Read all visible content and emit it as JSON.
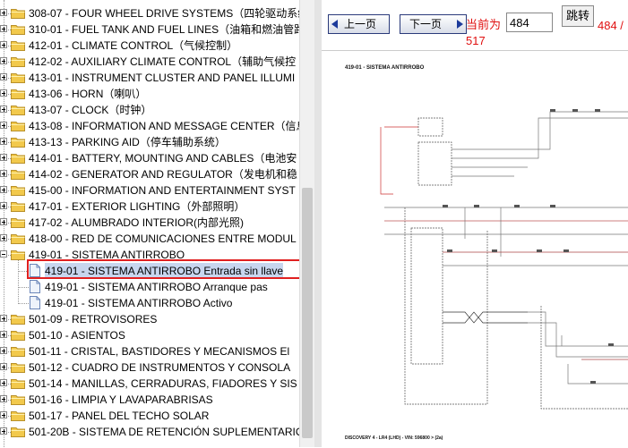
{
  "tree": {
    "items": [
      {
        "label": "308-07 - FOUR WHEEL DRIVE SYSTEMS（四轮驱动系统",
        "expand": "plus",
        "type": "folder"
      },
      {
        "label": "310-01 - FUEL TANK AND FUEL LINES（油箱和燃油管路",
        "expand": "plus",
        "type": "folder"
      },
      {
        "label": "412-01 - CLIMATE CONTROL（气候控制）",
        "expand": "plus",
        "type": "folder"
      },
      {
        "label": "412-02 - AUXILIARY CLIMATE CONTROL（辅助气候控",
        "expand": "plus",
        "type": "folder"
      },
      {
        "label": "413-01 - INSTRUMENT CLUSTER AND PANEL ILLUMI",
        "expand": "plus",
        "type": "folder"
      },
      {
        "label": "413-06 - HORN（喇叭）",
        "expand": "plus",
        "type": "folder"
      },
      {
        "label": "413-07 - CLOCK（时钟）",
        "expand": "plus",
        "type": "folder"
      },
      {
        "label": "413-08 - INFORMATION AND MESSAGE CENTER（信息",
        "expand": "plus",
        "type": "folder"
      },
      {
        "label": "413-13 - PARKING AID（停车辅助系统）",
        "expand": "plus",
        "type": "folder"
      },
      {
        "label": "414-01 - BATTERY, MOUNTING AND CABLES（电池安",
        "expand": "plus",
        "type": "folder"
      },
      {
        "label": "414-02 - GENERATOR AND REGULATOR（发电机和稳",
        "expand": "plus",
        "type": "folder"
      },
      {
        "label": "415-00 - INFORMATION AND ENTERTAINMENT SYST",
        "expand": "plus",
        "type": "folder"
      },
      {
        "label": "417-01 - EXTERIOR LIGHTING（外部照明）",
        "expand": "plus",
        "type": "folder"
      },
      {
        "label": "417-02 - ALUMBRADO INTERIOR(内部光照)",
        "expand": "plus",
        "type": "folder"
      },
      {
        "label": "418-00 - RED DE COMUNICACIONES ENTRE MODUL",
        "expand": "plus",
        "type": "folder"
      },
      {
        "label": "419-01 - SISTEMA ANTIRROBO",
        "expand": "minus",
        "type": "folder"
      },
      {
        "label": "419-01 - SISTEMA ANTIRROBO Entrada sin llave",
        "expand": "none",
        "type": "doc",
        "selected": true
      },
      {
        "label": "419-01 - SISTEMA ANTIRROBO Arranque pas",
        "expand": "none",
        "type": "doc"
      },
      {
        "label": "419-01 - SISTEMA ANTIRROBO Activo",
        "expand": "none",
        "type": "doc"
      },
      {
        "label": "501-09 - RETROVISORES",
        "expand": "plus",
        "type": "folder"
      },
      {
        "label": "501-10 - ASIENTOS",
        "expand": "plus",
        "type": "folder"
      },
      {
        "label": "501-11 - CRISTAL, BASTIDORES Y MECANISMOS El",
        "expand": "plus",
        "type": "folder"
      },
      {
        "label": "501-12 - CUADRO DE INSTRUMENTOS Y CONSOLA",
        "expand": "plus",
        "type": "folder"
      },
      {
        "label": "501-14 - MANILLAS, CERRADURAS, FIADORES Y SIS",
        "expand": "plus",
        "type": "folder"
      },
      {
        "label": "501-16 - LIMPIA Y LAVAPARABRISAS",
        "expand": "plus",
        "type": "folder"
      },
      {
        "label": "501-17 - PANEL DEL TECHO SOLAR",
        "expand": "plus",
        "type": "folder"
      },
      {
        "label": "501-20B - SISTEMA DE RETENCIÓN SUPLEMENTARIO",
        "expand": "plus",
        "type": "folder"
      }
    ]
  },
  "toolbar": {
    "prev_label": "上一页",
    "next_label": "下一页",
    "current_label": "当前为",
    "page_value": "484",
    "jump_label": "跳转",
    "page_count": "484 /",
    "page_total": "517"
  },
  "document": {
    "title": "419-01 - SISTEMA ANTIRROBO",
    "footer": "DISCOVERY 4 - LR4 (LHD) - VIN: 596800 > (2a)"
  },
  "colors": {
    "page_indicator": "#e01010",
    "selection_box": "#e02020",
    "folder": "#f2c94c"
  }
}
